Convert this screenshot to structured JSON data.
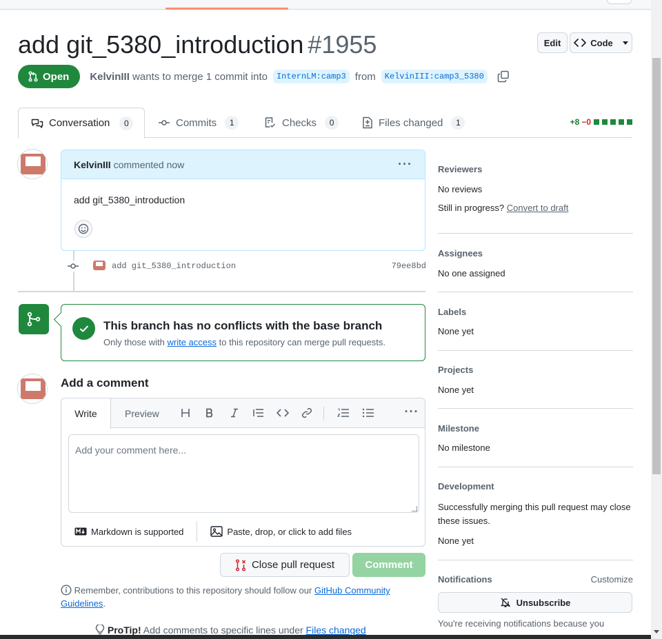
{
  "pr": {
    "title": "add git_5380_introduction",
    "number": "#1955",
    "state": "Open",
    "author": "KelvinIII",
    "merge_text": "wants to merge 1 commit into",
    "base_branch": "InternLM:camp3",
    "from_text": "from",
    "head_branch": "KelvinIII:camp3_5380"
  },
  "header_buttons": {
    "edit": "Edit",
    "code": "Code"
  },
  "tabs": [
    {
      "label": "Conversation",
      "count": "0"
    },
    {
      "label": "Commits",
      "count": "1"
    },
    {
      "label": "Checks",
      "count": "0"
    },
    {
      "label": "Files changed",
      "count": "1"
    }
  ],
  "diffstat": {
    "additions": "+8",
    "deletions": "−0"
  },
  "comment": {
    "author": "KelvinIII",
    "action": "commented now",
    "body": "add git_5380_introduction"
  },
  "commit": {
    "message": "add git_5380_introduction",
    "sha": "79ee8bd"
  },
  "merge_status": {
    "title": "This branch has no conflicts with the base branch",
    "sub_prefix": "Only those with",
    "sub_link": "write access",
    "sub_suffix": "to this repository can merge pull requests."
  },
  "add_comment": {
    "title": "Add a comment",
    "write_tab": "Write",
    "preview_tab": "Preview",
    "placeholder": "Add your comment here...",
    "markdown_note": "Markdown is supported",
    "attach_note": "Paste, drop, or click to add files",
    "close_button": "Close pull request",
    "comment_button": "Comment"
  },
  "remember": {
    "prefix": "Remember, contributions to this repository should follow our",
    "link": "GitHub Community Guidelines",
    "suffix": "."
  },
  "protip": {
    "label": "ProTip!",
    "text": "Add comments to specific lines under",
    "link": "Files changed"
  },
  "sidebar": {
    "reviewers": {
      "title": "Reviewers",
      "value": "No reviews",
      "draft_prefix": "Still in progress?",
      "draft_link": "Convert to draft"
    },
    "assignees": {
      "title": "Assignees",
      "value": "No one assigned"
    },
    "labels": {
      "title": "Labels",
      "value": "None yet"
    },
    "projects": {
      "title": "Projects",
      "value": "None yet"
    },
    "milestone": {
      "title": "Milestone",
      "value": "No milestone"
    },
    "development": {
      "title": "Development",
      "note": "Successfully merging this pull request may close these issues.",
      "value": "None yet"
    },
    "notifications": {
      "title": "Notifications",
      "customize": "Customize",
      "button": "Unsubscribe",
      "note": "You're receiving notifications because you"
    }
  },
  "colors": {
    "accent_green": "#1f883d",
    "link_blue": "#0969da",
    "tab_underline": "#fd8c73"
  }
}
